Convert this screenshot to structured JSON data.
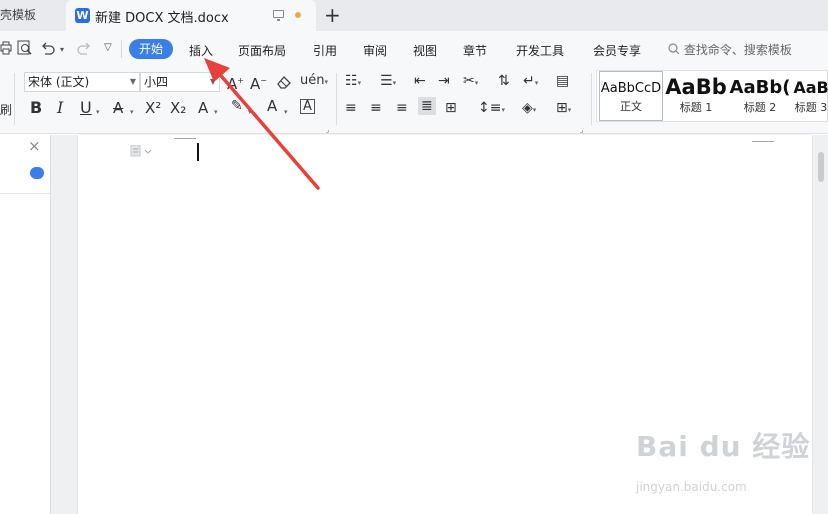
{
  "tabbar": {
    "inactive_tab": "找稻壳模板",
    "active_tab": {
      "title": "新建 DOCX 文档.docx",
      "logo": "W"
    },
    "new_tab": "+"
  },
  "menu": {
    "items": [
      {
        "label": "开始",
        "active": true
      },
      {
        "label": "插入"
      },
      {
        "label": "页面布局"
      },
      {
        "label": "引用"
      },
      {
        "label": "审阅"
      },
      {
        "label": "视图"
      },
      {
        "label": "章节"
      },
      {
        "label": "开发工具"
      },
      {
        "label": "会员专享"
      }
    ],
    "search": "查找命令、搜索模板",
    "quick_icons": [
      "print-icon",
      "print-preview-icon",
      "undo-icon",
      "redo-icon",
      "customize-icon"
    ]
  },
  "ribbon": {
    "font_name": "宋体 (正文)",
    "font_size": "小四",
    "format_painter_label": "刷",
    "styles": [
      {
        "preview": "AaBbCcD",
        "label": "正文"
      },
      {
        "preview": "AaBb",
        "label": "标题 1"
      },
      {
        "preview": "AaBb(",
        "label": "标题 2"
      },
      {
        "preview": "AaB",
        "label": "标题 3"
      }
    ],
    "format_buttons": [
      "B",
      "I",
      "U",
      "A",
      "X²",
      "X₂",
      "A",
      "A",
      "A"
    ],
    "accent_color": "#3a7ee8",
    "highlight_color": "#f5e23a",
    "font_color": "#2b3bd6"
  },
  "watermark": {
    "main": "Bai du 经验",
    "sub": "jingyan.baidu.com"
  },
  "annotation": {
    "color": "#e8403a"
  }
}
